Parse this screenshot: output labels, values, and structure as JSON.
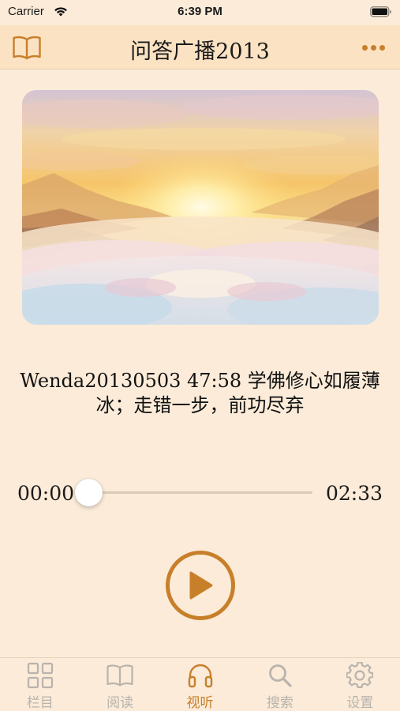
{
  "status_bar": {
    "carrier": "Carrier",
    "time": "6:39 PM"
  },
  "nav": {
    "title": "问答广播2013",
    "left_icon": "book-icon",
    "right_icon": "more-icon"
  },
  "player": {
    "artwork": "sunrise-over-clouds",
    "track_title": "Wenda20130503 47:58 学佛修心如履薄冰；走错一步，前功尽弃",
    "current_time": "00:00",
    "total_time": "02:33",
    "progress": 0
  },
  "tabs": [
    {
      "label": "栏目",
      "icon": "grid-icon",
      "active": false
    },
    {
      "label": "阅读",
      "icon": "book-icon",
      "active": false
    },
    {
      "label": "视听",
      "icon": "headphones-icon",
      "active": true
    },
    {
      "label": "搜索",
      "icon": "search-icon",
      "active": false
    },
    {
      "label": "设置",
      "icon": "gear-icon",
      "active": false
    }
  ],
  "colors": {
    "accent": "#c87f2a",
    "background": "#fbebd8",
    "nav_background": "#fbe2c2",
    "inactive": "#b9b3ad"
  }
}
